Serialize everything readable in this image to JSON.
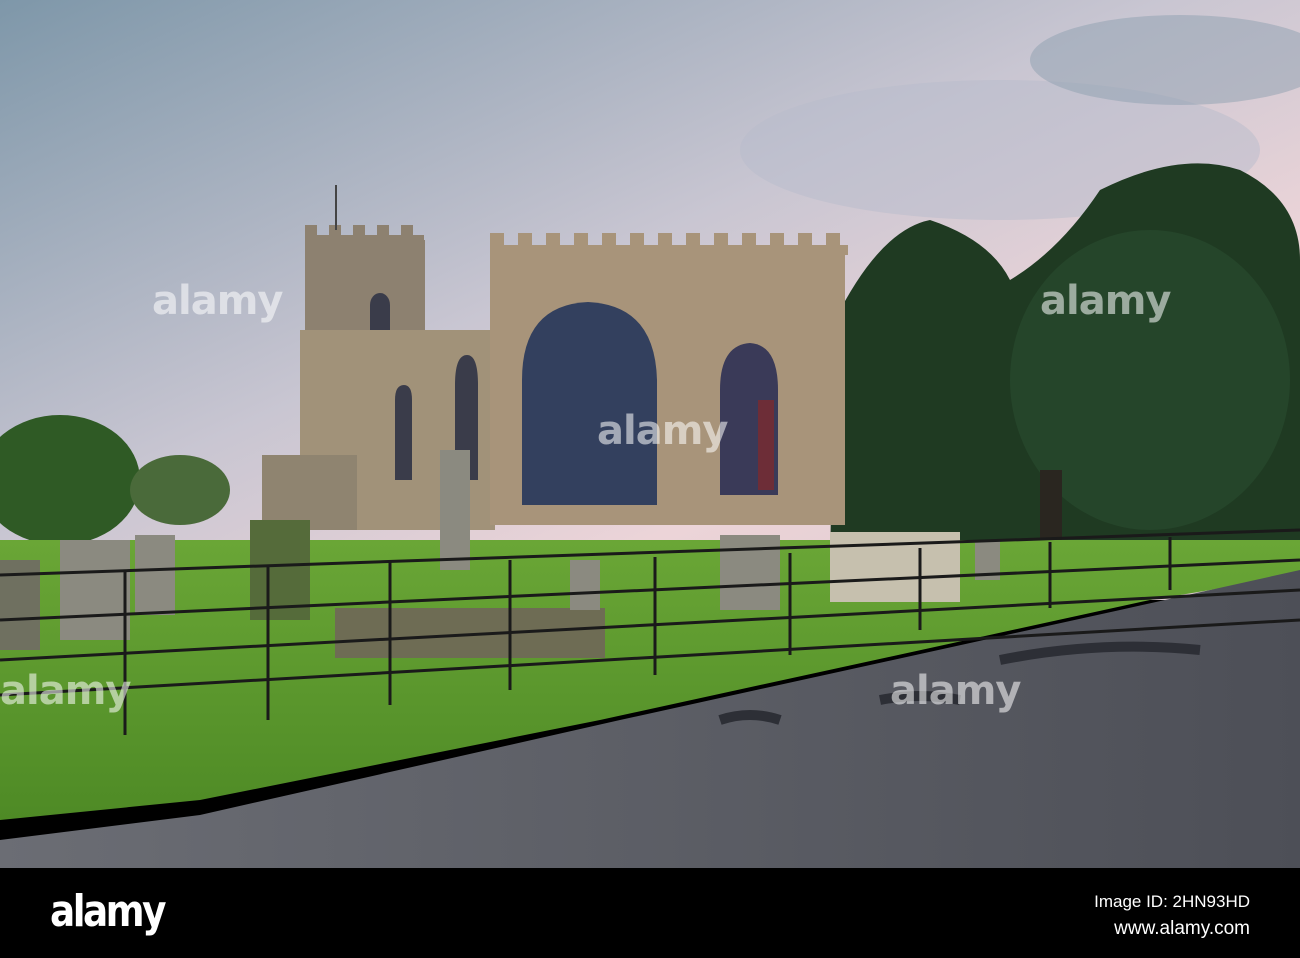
{
  "photo": {
    "subject": "church",
    "watermark_text": "alamy",
    "colors": {
      "sky_top": "#7f97a8",
      "sky_pink": "#e8c9d1",
      "stone": "#9a8a70",
      "grass": "#5f9a2c",
      "road": "#5c5e66",
      "trees": "#1f3a22"
    }
  },
  "footer": {
    "logo": "alamy",
    "image_id": "Image ID: 2HN93HD",
    "website": "www.alamy.com"
  }
}
